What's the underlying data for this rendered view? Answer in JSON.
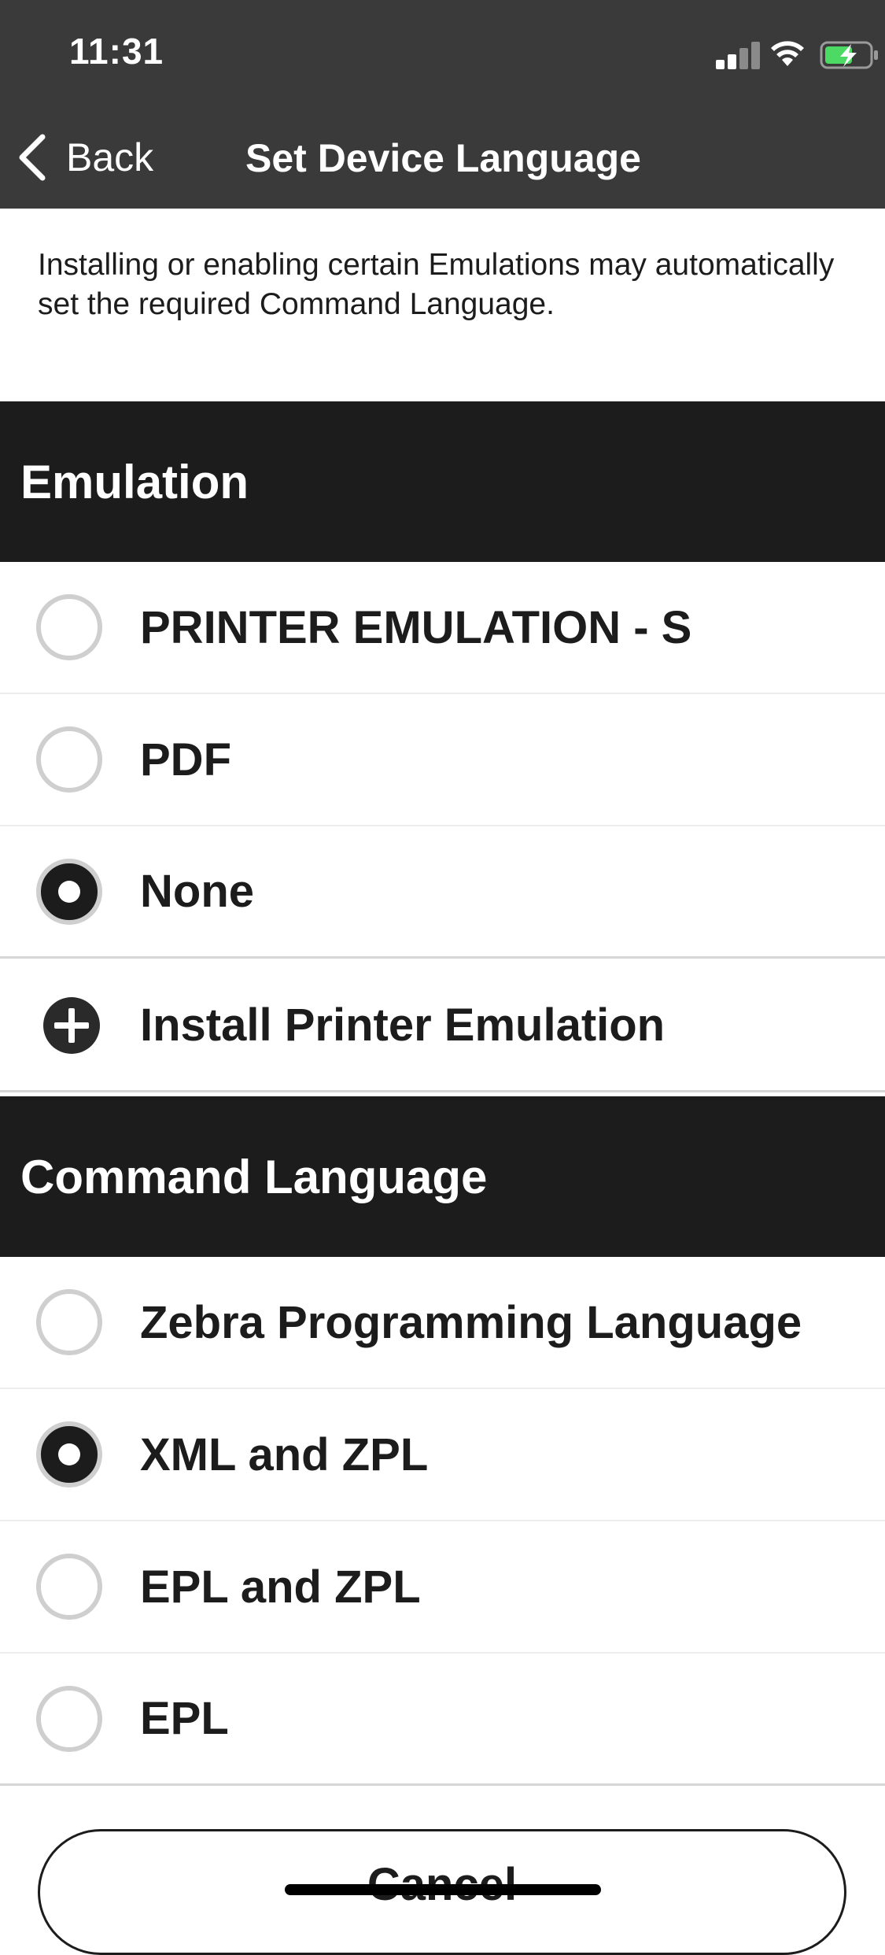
{
  "status_bar": {
    "time": "11:31",
    "icons": [
      "signal-icon",
      "wifi-icon",
      "battery-charging-icon"
    ]
  },
  "nav": {
    "back_label": "Back",
    "title": "Set Device Language"
  },
  "info_text": "Installing or enabling certain Emulations may automatically set the required Command Language.",
  "emulation": {
    "header": "Emulation",
    "options": [
      {
        "label": "PRINTER EMULATION - S",
        "selected": false
      },
      {
        "label": "PDF",
        "selected": false
      },
      {
        "label": "None",
        "selected": true
      }
    ],
    "install_label": "Install Printer Emulation"
  },
  "command_language": {
    "header": "Command Language",
    "options": [
      {
        "label": "Zebra Programming Language",
        "selected": false
      },
      {
        "label": "XML and ZPL",
        "selected": true
      },
      {
        "label": "EPL and ZPL",
        "selected": false
      },
      {
        "label": "EPL",
        "selected": false
      }
    ]
  },
  "cancel_label": "Cancel",
  "colors": {
    "header_bg": "#3a3a3a",
    "section_bg": "#1c1c1c",
    "battery": "#4cd964"
  }
}
